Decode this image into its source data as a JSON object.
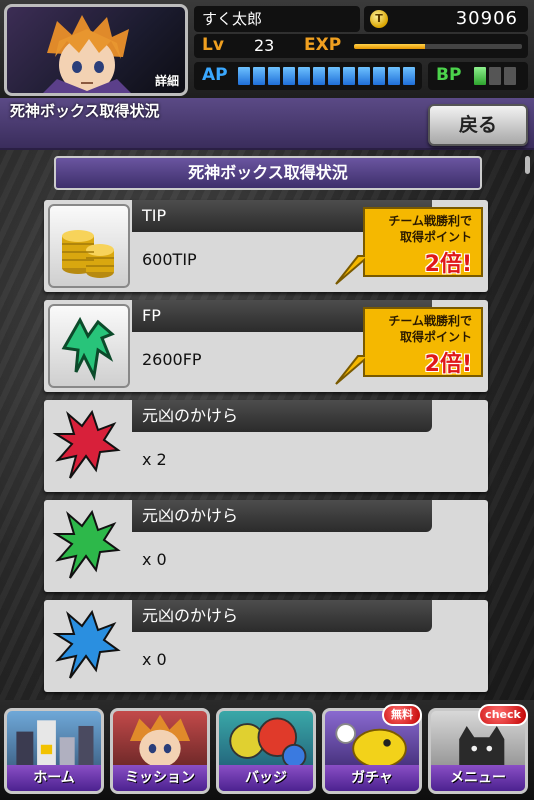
{
  "header": {
    "detail_label": "詳細",
    "player_name": "すく太郎",
    "coin_symbol": "T",
    "coins": "30906",
    "lv_label": "Lv",
    "level": "23",
    "exp_label": "EXP",
    "exp_progress": 0.42,
    "ap_label": "AP",
    "ap_segments_filled": 12,
    "ap_segments_total": 12,
    "bp_label": "BP",
    "bp_segments_filled": 1,
    "bp_segments_total": 3
  },
  "title_band": {
    "title": "死神ボックス取得状況",
    "back_label": "戻る"
  },
  "section_heading": "死神ボックス取得状況",
  "items": [
    {
      "name": "TIP",
      "value": "600TIP",
      "icon": "coin-stack-icon",
      "bonus": {
        "line1": "チーム戦勝利で",
        "line2": "取得ポイント",
        "line3": "2倍!"
      }
    },
    {
      "name": "FP",
      "value": "2600FP",
      "icon": "fp-arrow-icon",
      "bonus": {
        "line1": "チーム戦勝利で",
        "line2": "取得ポイント",
        "line3": "2倍!"
      }
    },
    {
      "name": "元凶のかけら",
      "value": "x 2",
      "icon": "red-fragment-icon",
      "color": "#d8203a"
    },
    {
      "name": "元凶のかけら",
      "value": "x 0",
      "icon": "green-fragment-icon",
      "color": "#2db84a"
    },
    {
      "name": "元凶のかけら",
      "value": "x 0",
      "icon": "blue-fragment-icon",
      "color": "#2a8fe0"
    }
  ],
  "nav": [
    {
      "label": "ホーム",
      "icon": "home-icon"
    },
    {
      "label": "ミッション",
      "icon": "mission-icon"
    },
    {
      "label": "バッジ",
      "icon": "badge-icon"
    },
    {
      "label": "ガチャ",
      "icon": "gacha-icon",
      "badge": "無料"
    },
    {
      "label": "メニュー",
      "icon": "menu-icon",
      "badge": "check"
    }
  ]
}
